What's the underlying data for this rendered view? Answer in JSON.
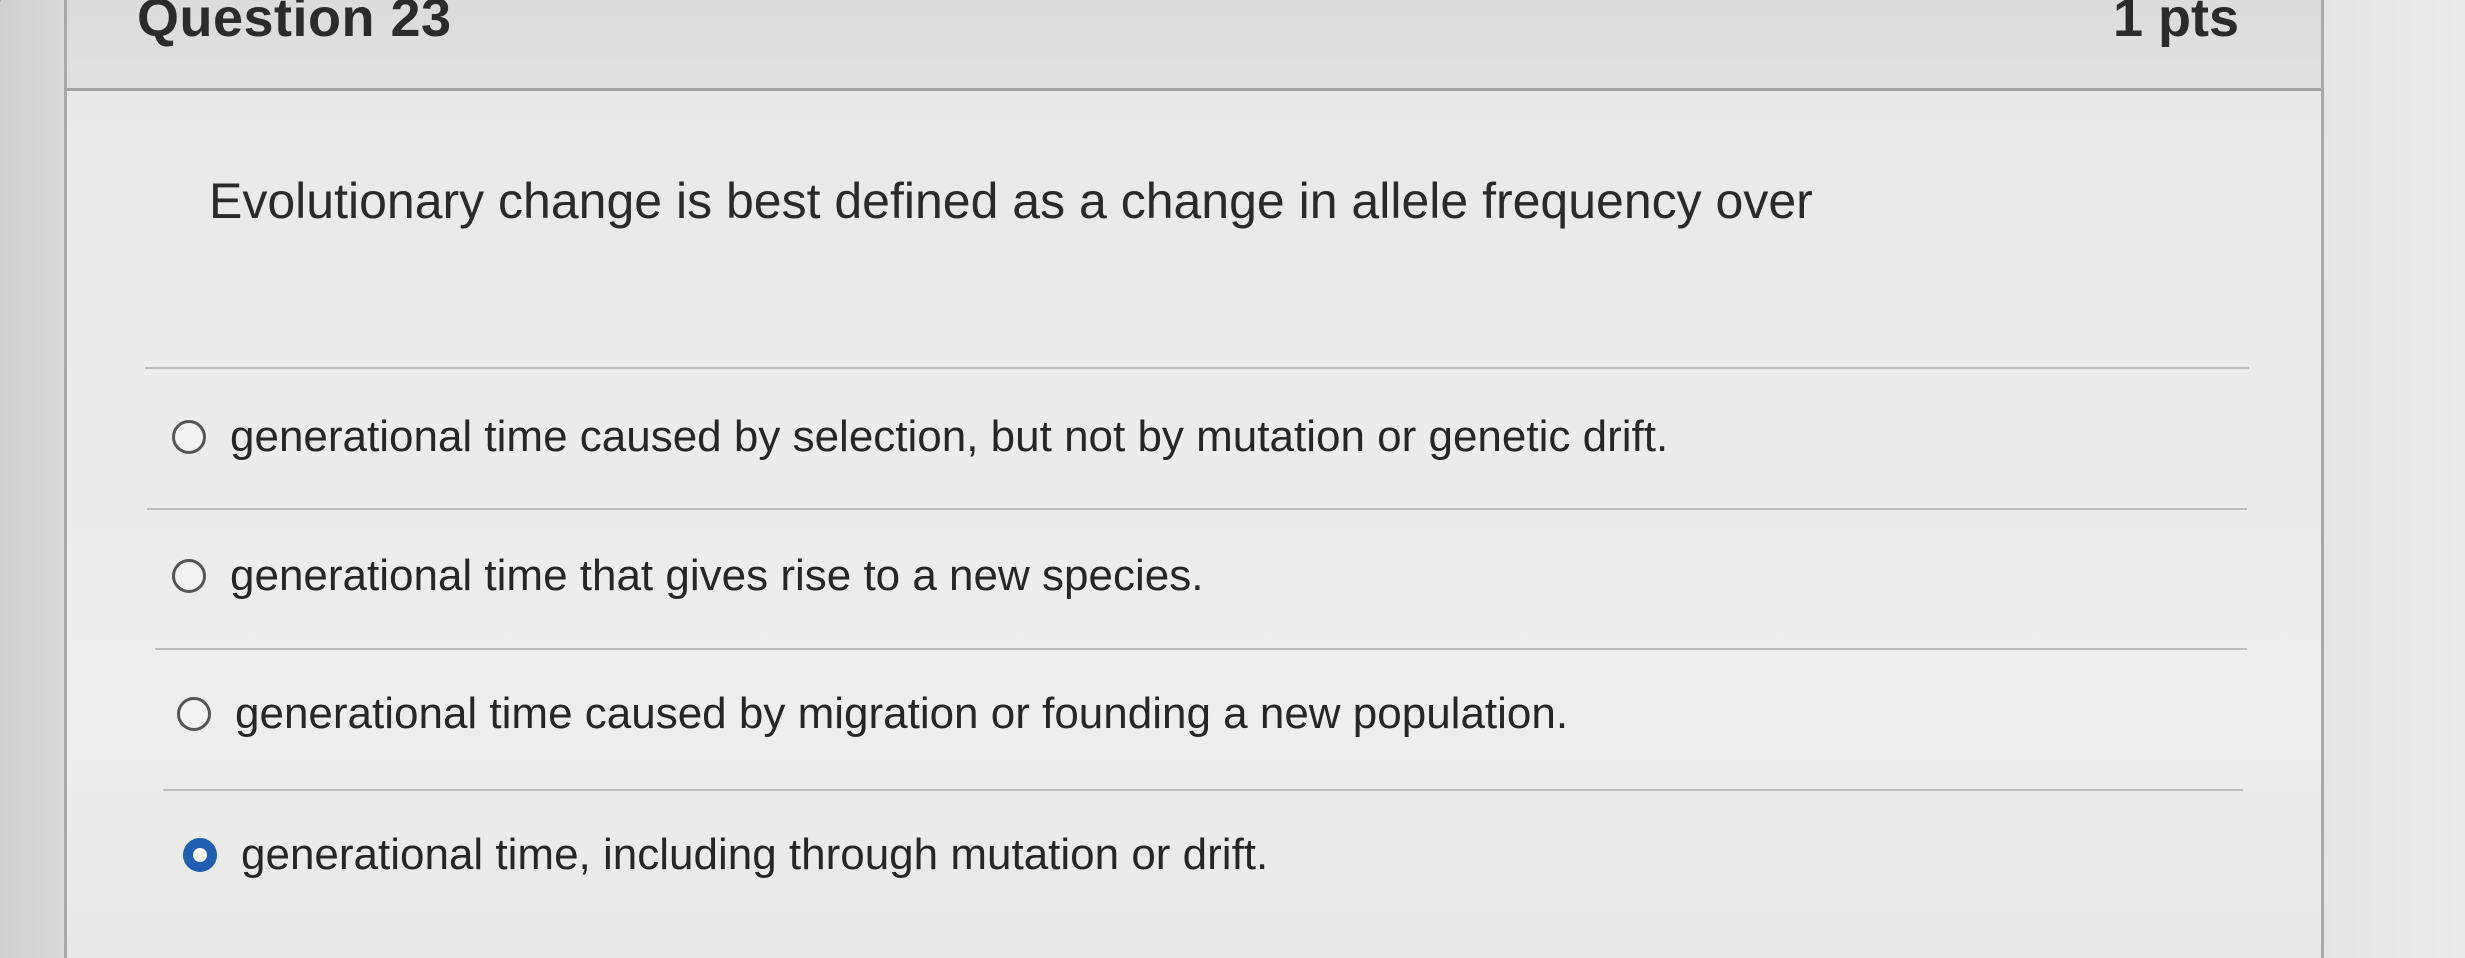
{
  "question": {
    "title": "Question 23",
    "points": "1 pts",
    "prompt": "Evolutionary change is best defined as a change in allele frequency over"
  },
  "answers": [
    {
      "text": "generational time caused by selection, but not by mutation or genetic drift.",
      "selected": false
    },
    {
      "text": "generational time that gives rise to a new species.",
      "selected": false
    },
    {
      "text": "generational time caused by migration or founding a new population.",
      "selected": false
    },
    {
      "text": "generational time, including through mutation or drift.",
      "selected": true
    }
  ],
  "colors": {
    "selected_radio": "#1f5fb0",
    "text": "#2a2a2a",
    "divider": "#bdbdbd"
  },
  "icons": {
    "left_nav": "chevron-right-icon"
  }
}
